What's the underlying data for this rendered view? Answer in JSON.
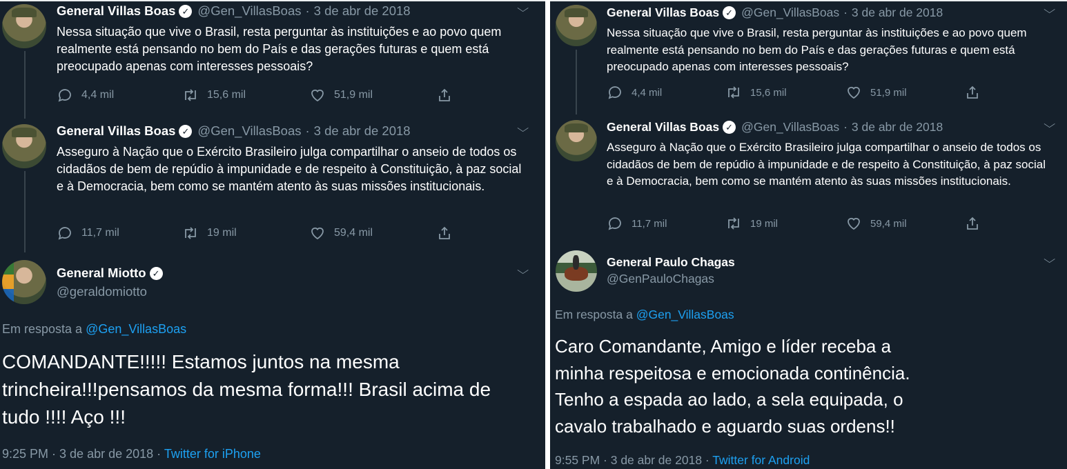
{
  "left": {
    "tweets": [
      {
        "name": "General Villas Boas",
        "handle": "@Gen_VillasBoas",
        "date": "3 de abr de 2018",
        "text": "Nessa situação que vive o Brasil, resta perguntar às instituições e ao povo quem realmente está pensando no bem do País e das gerações futuras e quem está preocupado apenas com interesses pessoais?",
        "replies": "4,4 mil",
        "retweets": "15,6 mil",
        "likes": "51,9 mil"
      },
      {
        "name": "General Villas Boas",
        "handle": "@Gen_VillasBoas",
        "date": "3 de abr de 2018",
        "text": "Asseguro à Nação que o Exército Brasileiro julga compartilhar o anseio de todos os cidadãos de bem de repúdio à impunidade e de respeito à Constituição, à paz social e à Democracia, bem como se mantém atento às suas missões institucionais.",
        "replies": "11,7 mil",
        "retweets": "19 mil",
        "likes": "59,4 mil"
      }
    ],
    "reply": {
      "name": "General Miotto",
      "handle": "@geraldomiotto",
      "reply_prefix": "Em resposta a",
      "reply_to": "@Gen_VillasBoas",
      "text": "COMANDANTE!!!!! Estamos juntos na mesma trincheira!!!pensamos da mesma forma!!! Brasil acima de tudo !!!! Aço !!!",
      "time": "9:25 PM · 3 de abr de 2018 ·",
      "source": "Twitter for iPhone"
    }
  },
  "right": {
    "tweets": [
      {
        "name": "General Villas Boas",
        "handle": "@Gen_VillasBoas",
        "date": "3 de abr de 2018",
        "text": "Nessa situação que vive o Brasil, resta perguntar às instituições e ao povo quem realmente está pensando no bem do País e das gerações futuras e quem está preocupado apenas com interesses pessoais?",
        "replies": "4,4 mil",
        "retweets": "15,6 mil",
        "likes": "51,9 mil"
      },
      {
        "name": "General Villas Boas",
        "handle": "@Gen_VillasBoas",
        "date": "3 de abr de 2018",
        "text": "Asseguro à Nação que o Exército Brasileiro julga compartilhar o anseio de todos os cidadãos de bem de repúdio à impunidade e de respeito à Constituição, à paz social e à Democracia, bem como se mantém atento às suas missões institucionais.",
        "replies": "11,7 mil",
        "retweets": "19 mil",
        "likes": "59,4 mil"
      }
    ],
    "reply": {
      "name": "General Paulo Chagas",
      "handle": "@GenPauloChagas",
      "reply_prefix": "Em resposta a",
      "reply_to": "@Gen_VillasBoas",
      "text_line1": "Caro Comandante, Amigo e líder receba a minha respeitosa e emocionada continência.",
      "text_line2": "Tenho a espada ao lado, a sela equipada, o cavalo trabalhado e aguardo suas ordens!!",
      "time": "9:55 PM · 3 de abr de 2018 ·",
      "source": "Twitter for Android"
    }
  },
  "icons": {
    "verified": "✓",
    "chevron": "⌵"
  },
  "colors": {
    "background": "#15202b",
    "text": "#ffffff",
    "muted": "#8899a6",
    "link": "#1da1f2"
  }
}
